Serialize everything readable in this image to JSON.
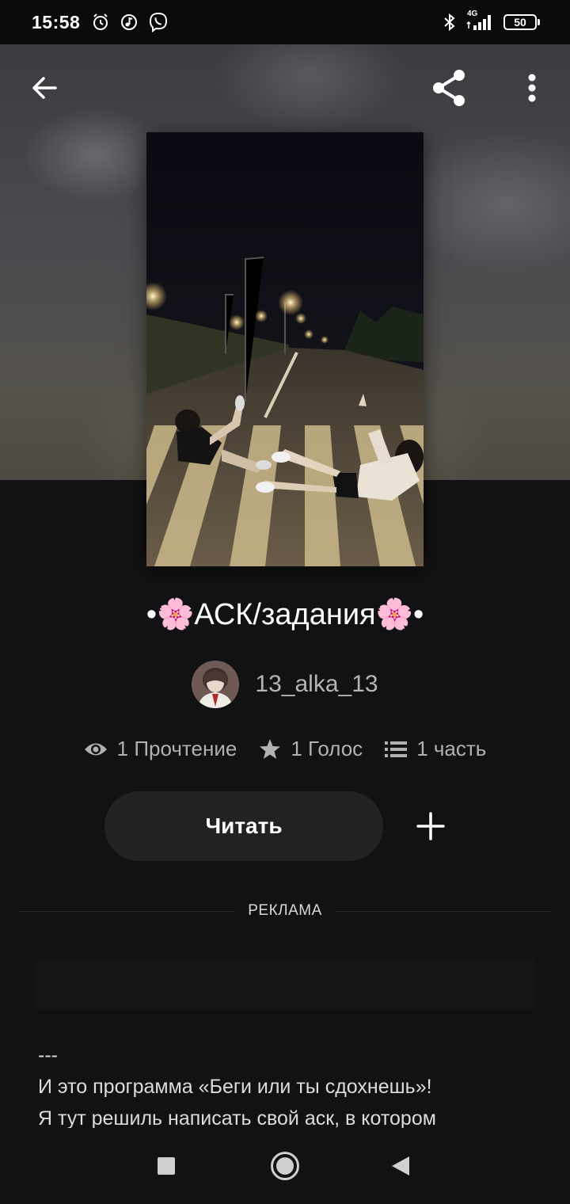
{
  "status_bar": {
    "time": "15:58",
    "network": "4G",
    "battery": "50",
    "icons_left": [
      "alarm-icon",
      "music-icon",
      "viber-icon"
    ],
    "icons_right": [
      "bluetooth-icon",
      "signal-icon",
      "battery-icon"
    ]
  },
  "toolbar": {
    "back_icon": "arrow-left-icon",
    "share_icon": "share-icon",
    "more_icon": "more-vertical-icon"
  },
  "story": {
    "title": "•🌸АСК/задания🌸•",
    "author": "13_alka_13",
    "stats": {
      "reads": "1 Прочтение",
      "votes": "1 Голос",
      "parts": "1 часть"
    },
    "read_label": "Читать",
    "description_lines": [
      "---",
      "И это программа «Беги или ты сдохнешь»!",
      "Я тут решиль написать свой аск, в котором"
    ]
  },
  "ad": {
    "label": "РЕКЛАМА"
  },
  "nav": {
    "buttons": [
      "recents-icon",
      "home-icon",
      "back-triangle-icon"
    ]
  },
  "colors": {
    "background": "#121113",
    "button_bg": "#222124",
    "muted_text": "#b1b1b4"
  }
}
